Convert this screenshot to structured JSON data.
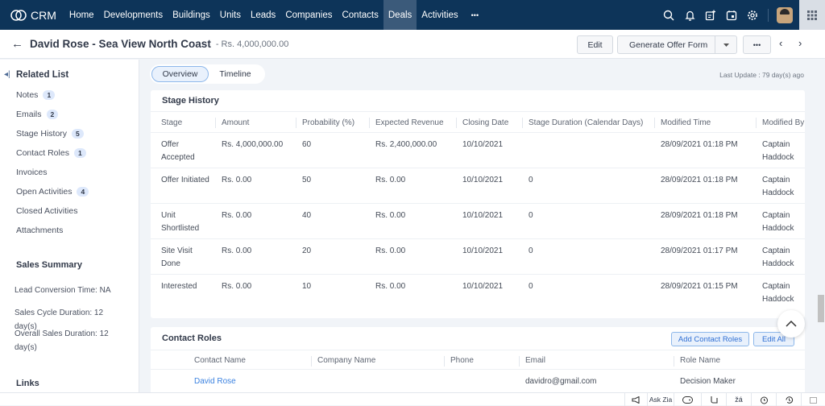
{
  "app": {
    "name": "CRM"
  },
  "nav": {
    "items": [
      "Home",
      "Developments",
      "Buildings",
      "Units",
      "Leads",
      "Companies",
      "Contacts",
      "Deals",
      "Activities"
    ],
    "active": "Deals",
    "more": "•••"
  },
  "header": {
    "title": "David Rose - Sea View North Coast",
    "amount": "- Rs. 4,000,000.00",
    "edit_label": "Edit",
    "offer_label": "Generate Offer Form",
    "more_label": "•••"
  },
  "sidebar": {
    "related_title": "Related List",
    "items": [
      {
        "label": "Notes",
        "count": "1"
      },
      {
        "label": "Emails",
        "count": "2"
      },
      {
        "label": "Stage History",
        "count": "5"
      },
      {
        "label": "Contact Roles",
        "count": "1"
      },
      {
        "label": "Invoices",
        "count": ""
      },
      {
        "label": "Open Activities",
        "count": "4"
      },
      {
        "label": "Closed Activities",
        "count": ""
      },
      {
        "label": "Attachments",
        "count": ""
      }
    ],
    "sales_title": "Sales Summary",
    "sales": [
      "Lead Conversion Time: NA",
      "Sales Cycle Duration: 12 day(s)",
      "Overall Sales Duration: 12 day(s)"
    ],
    "links_title": "Links"
  },
  "tabs": {
    "overview": "Overview",
    "timeline": "Timeline"
  },
  "last_update": "Last Update : 79 day(s) ago",
  "stage_history": {
    "title": "Stage History",
    "columns": [
      "Stage",
      "Amount",
      "Probability (%)",
      "Expected Revenue",
      "Closing Date",
      "Stage Duration (Calendar Days)",
      "Modified Time",
      "Modified By"
    ],
    "rows": [
      [
        "Offer Accepted",
        "Rs. 4,000,000.00",
        "60",
        "Rs. 2,400,000.00",
        "10/10/2021",
        "",
        "28/09/2021 01:18 PM",
        "Captain Haddock"
      ],
      [
        "Offer Initiated",
        "Rs. 0.00",
        "50",
        "Rs. 0.00",
        "10/10/2021",
        "0",
        "28/09/2021 01:18 PM",
        "Captain Haddock"
      ],
      [
        "Unit Shortlisted",
        "Rs. 0.00",
        "40",
        "Rs. 0.00",
        "10/10/2021",
        "0",
        "28/09/2021 01:18 PM",
        "Captain Haddock"
      ],
      [
        "Site Visit Done",
        "Rs. 0.00",
        "20",
        "Rs. 0.00",
        "10/10/2021",
        "0",
        "28/09/2021 01:17 PM",
        "Captain Haddock"
      ],
      [
        "Interested",
        "Rs. 0.00",
        "10",
        "Rs. 0.00",
        "10/10/2021",
        "0",
        "28/09/2021 01:15 PM",
        "Captain Haddock"
      ]
    ]
  },
  "contact_roles": {
    "title": "Contact Roles",
    "add_label": "Add Contact Roles",
    "edit_all_label": "Edit All",
    "columns": [
      "Contact Name",
      "Company Name",
      "Phone",
      "Email",
      "Role Name"
    ],
    "rows": [
      [
        "David Rose",
        "",
        "",
        "davidro@gmail.com",
        "Decision Maker"
      ]
    ]
  },
  "bottombar": {
    "ask_zia": "Ask Zia"
  }
}
